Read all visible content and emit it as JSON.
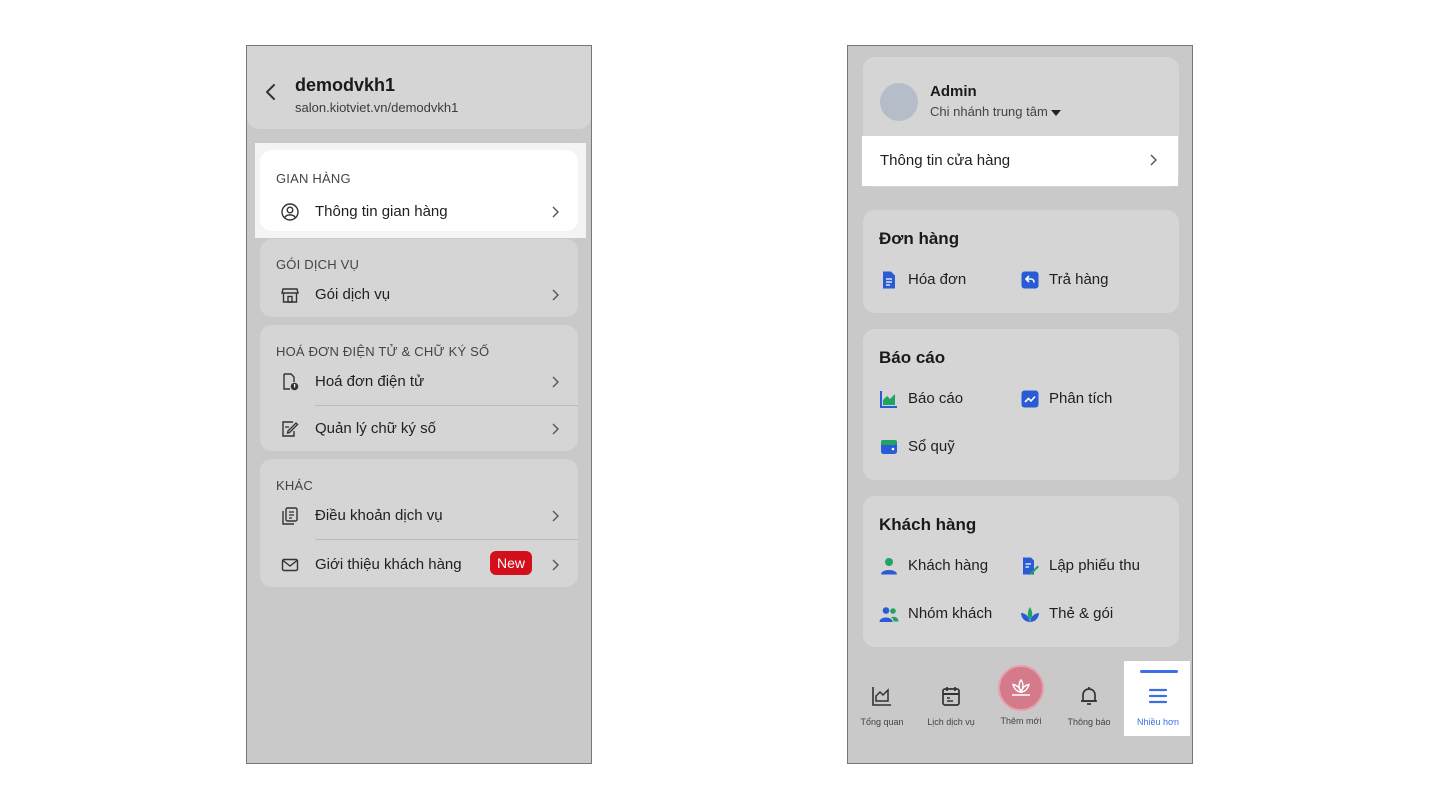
{
  "left": {
    "header": {
      "title": "demodvkh1",
      "subtitle": "salon.kiotviet.vn/demodvkh1"
    },
    "sections": [
      {
        "title": "GIAN HÀNG",
        "items": [
          {
            "label": "Thông tin gian hàng",
            "icon": "user-circle-icon"
          }
        ]
      },
      {
        "title": "GÓI DỊCH VỤ",
        "items": [
          {
            "label": "Gói dịch vụ",
            "icon": "store-icon"
          }
        ]
      },
      {
        "title": "HOÁ ĐƠN ĐIỆN TỬ & CHỮ KÝ SỐ",
        "items": [
          {
            "label": "Hoá đơn điện tử",
            "icon": "e-invoice-icon"
          },
          {
            "label": "Quản lý chữ ký số",
            "icon": "signature-icon"
          }
        ]
      },
      {
        "title": "KHÁC",
        "items": [
          {
            "label": "Điều khoản dịch vụ",
            "icon": "document-icon"
          },
          {
            "label": "Giới thiệu khách hàng",
            "icon": "mail-icon",
            "badge": "New"
          }
        ]
      }
    ]
  },
  "right": {
    "profile": {
      "name": "Admin",
      "branch": "Chi nhánh trung tâm"
    },
    "store_info": "Thông tin cửa hàng",
    "orders": {
      "title": "Đơn hàng",
      "items": [
        "Hóa đơn",
        "Trả hàng"
      ]
    },
    "reports": {
      "title": "Báo cáo",
      "items": [
        "Báo cáo",
        "Phân tích",
        "Sổ quỹ"
      ]
    },
    "customers": {
      "title": "Khách hàng",
      "items": [
        "Khách hàng",
        "Lập phiếu thu",
        "Nhóm khách",
        "Thẻ & gói"
      ]
    },
    "tabbar": {
      "overview": "Tổng quan",
      "schedule": "Lịch dịch vụ",
      "add_new": "Thêm mới",
      "notifications": "Thông báo",
      "more": "Nhiều hơn"
    }
  },
  "colors": {
    "accent": "#3a6fe6",
    "badge": "#d20f1b",
    "fab": "#d47a8a",
    "icon_blue": "#2a5bd7",
    "icon_green": "#1fa463"
  }
}
